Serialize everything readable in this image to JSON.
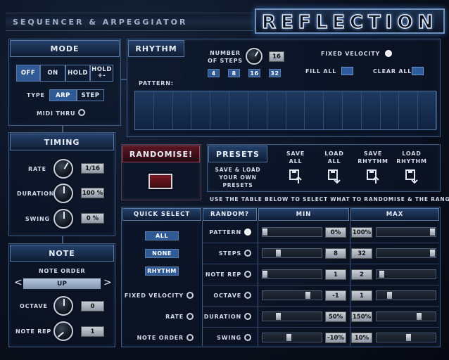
{
  "app": {
    "title": "REFLECTION",
    "subtitle": "SEQUENCER & ARPEGGIATOR"
  },
  "mode": {
    "title": "MODE",
    "buttons": [
      "OFF",
      "ON",
      "HOLD",
      "HOLD +-"
    ],
    "selected": "OFF",
    "type_label": "TYPE",
    "type_options": [
      "ARP",
      "STEP"
    ],
    "type_selected": "ARP",
    "midi_thru": "MIDI THRU"
  },
  "timing": {
    "title": "TIMING",
    "rate": {
      "label": "RATE",
      "value": "1/16"
    },
    "duration": {
      "label": "DURATION",
      "value": "100 %"
    },
    "swing": {
      "label": "SWING",
      "value": "0 %"
    }
  },
  "note": {
    "title": "NOTE",
    "order_label": "NOTE ORDER",
    "order_value": "UP",
    "prev": "<",
    "next": ">",
    "octave": {
      "label": "OCTAVE",
      "value": "0"
    },
    "note_rep": {
      "label": "NOTE REP",
      "value": "1"
    }
  },
  "rhythm": {
    "title": "RHYTHM",
    "steps_label": "NUMBER OF STEPS",
    "steps_value": "16",
    "step_options": [
      "4",
      "8",
      "16",
      "32"
    ],
    "fixed_velocity": "FIXED VELOCITY",
    "fill_all": "FILL ALL",
    "clear_all": "CLEAR ALL",
    "pattern_label": "PATTERN:",
    "pattern_steps": 16
  },
  "randomise": {
    "label": "RANDOMISE!"
  },
  "presets": {
    "title": "PRESETS",
    "note": "SAVE & LOAD YOUR OWN PRESETS",
    "actions": [
      {
        "top": "SAVE",
        "bottom": "ALL",
        "icon": "save-icon"
      },
      {
        "top": "LOAD",
        "bottom": "ALL",
        "icon": "load-icon"
      },
      {
        "top": "SAVE",
        "bottom": "RHYTHM",
        "icon": "save-icon"
      },
      {
        "top": "LOAD",
        "bottom": "RHYTHM",
        "icon": "load-icon"
      }
    ],
    "instruction": "USE THE TABLE BELOW TO SELECT WHAT TO RANDOMISE & THE RANGES"
  },
  "table": {
    "headers": {
      "quick": "QUICK SELECT",
      "random": "RANDOM?",
      "min": "MIN",
      "max": "MAX"
    },
    "quick_buttons": [
      "ALL",
      "NONE",
      "RHYTHM"
    ],
    "quick_radios": [
      "FIXED VELOCITY",
      "RATE",
      "NOTE ORDER"
    ],
    "rows": [
      {
        "name": "PATTERN",
        "on": true,
        "min": "0%",
        "max": "100%",
        "min_pos": 0.0,
        "max_pos": 1.0
      },
      {
        "name": "STEPS",
        "on": false,
        "min": "8",
        "max": "32",
        "min_pos": 0.25,
        "max_pos": 1.0
      },
      {
        "name": "NOTE REP",
        "on": false,
        "min": "1",
        "max": "2",
        "min_pos": 0.0,
        "max_pos": 0.05
      },
      {
        "name": "OCTAVE",
        "on": false,
        "min": "-1",
        "max": "1",
        "min_pos": 0.8,
        "max_pos": 0.2
      },
      {
        "name": "DURATION",
        "on": false,
        "min": "50%",
        "max": "150%",
        "min_pos": 0.25,
        "max_pos": 0.75
      },
      {
        "name": "SWING",
        "on": false,
        "min": "-10%",
        "max": "10%",
        "min_pos": 0.45,
        "max_pos": 0.55
      }
    ]
  }
}
